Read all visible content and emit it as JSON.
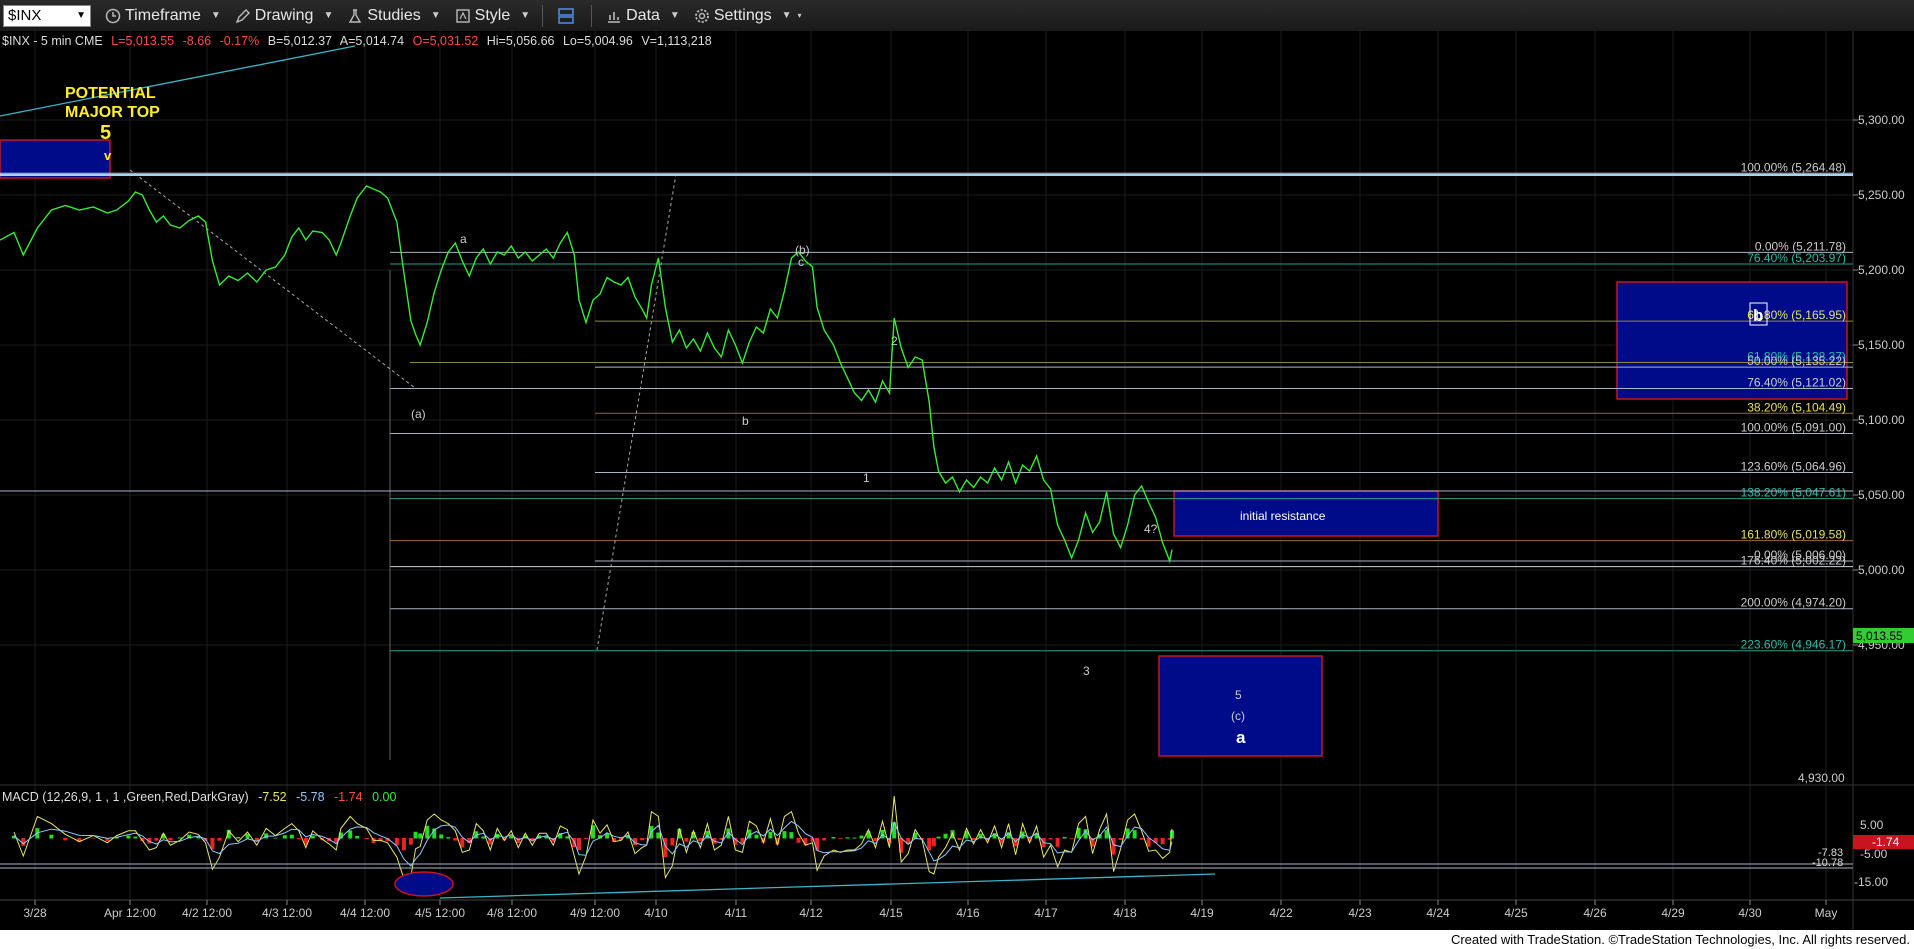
{
  "toolbar": {
    "symbol": "$INX",
    "timeframe": "Timeframe",
    "drawing": "Drawing",
    "studies": "Studies",
    "style": "Style",
    "data": "Data",
    "settings": "Settings"
  },
  "footer": "Created with TradeStation. ©TradeStation Technologies, Inc. All rights reserved.",
  "colors": {
    "price_line": "#33ee33",
    "fib_line": "#aab4c8",
    "box_fill": "#000b8a",
    "box_stroke": "#c8141e",
    "label_yellow": "#ffee22"
  },
  "chart_data": {
    "type": "line",
    "header": {
      "symbol": "$INX - 5 min  CME",
      "last": "L=5,013.55",
      "change": "-8.66",
      "pct": "-0.17%",
      "bid": "B=5,012.37",
      "ask": "A=5,014.74",
      "open": "O=5,031.52",
      "high": "Hi=5,056.66",
      "low": "Lo=5,004.96",
      "volume": "V=1,113,218"
    },
    "x_ticks": [
      "3/28",
      "Apr 12:00",
      "4/2 12:00",
      "4/3 12:00",
      "4/4 12:00",
      "4/5 12:00",
      "4/8 12:00",
      "4/9 12:00",
      "4/10",
      "4/11",
      "4/12",
      "4/15",
      "4/16",
      "4/17",
      "4/18",
      "4/19",
      "4/22",
      "4/23",
      "4/24",
      "4/25",
      "4/26",
      "4/29",
      "4/30",
      "May"
    ],
    "y_ticks": [
      "5,300.00",
      "5,250.00",
      "5,200.00",
      "5,150.00",
      "5,100.00",
      "5,050.00",
      "5,000.00",
      "4,950.00"
    ],
    "ylim": [
      4930,
      5325
    ],
    "last_price_badge": "5,013.55",
    "low_label": "4,930.00",
    "price_series": [
      [
        0,
        5220
      ],
      [
        6,
        5225
      ],
      [
        10,
        5210
      ],
      [
        16,
        5228
      ],
      [
        22,
        5240
      ],
      [
        28,
        5243
      ],
      [
        34,
        5240
      ],
      [
        40,
        5242
      ],
      [
        46,
        5238
      ],
      [
        50,
        5240
      ],
      [
        55,
        5246
      ],
      [
        58,
        5252
      ],
      [
        61,
        5250
      ],
      [
        64,
        5240
      ],
      [
        67,
        5232
      ],
      [
        70,
        5236
      ],
      [
        73,
        5230
      ],
      [
        77,
        5228
      ],
      [
        81,
        5233
      ],
      [
        85,
        5236
      ],
      [
        88,
        5232
      ],
      [
        91,
        5206
      ],
      [
        94,
        5190
      ],
      [
        98,
        5196
      ],
      [
        102,
        5193
      ],
      [
        106,
        5198
      ],
      [
        110,
        5192
      ],
      [
        114,
        5200
      ],
      [
        118,
        5202
      ],
      [
        122,
        5210
      ],
      [
        125,
        5222
      ],
      [
        128,
        5228
      ],
      [
        131,
        5220
      ],
      [
        134,
        5226
      ],
      [
        138,
        5225
      ],
      [
        141,
        5220
      ],
      [
        144,
        5210
      ],
      [
        146,
        5218
      ],
      [
        150,
        5236
      ],
      [
        153,
        5248
      ],
      [
        157,
        5256
      ],
      [
        160,
        5254
      ],
      [
        163,
        5252
      ],
      [
        166,
        5248
      ],
      [
        170,
        5232
      ],
      [
        173,
        5198
      ],
      [
        176,
        5166
      ],
      [
        178,
        5157
      ],
      [
        180,
        5150
      ],
      [
        183,
        5165
      ],
      [
        186,
        5185
      ],
      [
        189,
        5200
      ],
      [
        192,
        5212
      ],
      [
        195,
        5218
      ],
      [
        198,
        5206
      ],
      [
        201,
        5196
      ],
      [
        204,
        5208
      ],
      [
        207,
        5214
      ],
      [
        210,
        5204
      ],
      [
        213,
        5212
      ],
      [
        216,
        5210
      ],
      [
        219,
        5216
      ],
      [
        222,
        5208
      ],
      [
        225,
        5212
      ],
      [
        228,
        5206
      ],
      [
        231,
        5210
      ],
      [
        234,
        5214
      ],
      [
        237,
        5208
      ],
      [
        240,
        5218
      ],
      [
        243,
        5225
      ],
      [
        246,
        5210
      ],
      [
        248,
        5180
      ],
      [
        251,
        5165
      ],
      [
        254,
        5180
      ],
      [
        257,
        5184
      ],
      [
        260,
        5195
      ],
      [
        263,
        5192
      ],
      [
        266,
        5190
      ],
      [
        269,
        5195
      ],
      [
        272,
        5182
      ],
      [
        275,
        5174
      ],
      [
        277,
        5168
      ],
      [
        279,
        5190
      ],
      [
        282,
        5208
      ],
      [
        285,
        5175
      ],
      [
        288,
        5152
      ],
      [
        291,
        5160
      ],
      [
        294,
        5148
      ],
      [
        297,
        5154
      ],
      [
        300,
        5146
      ],
      [
        303,
        5158
      ],
      [
        306,
        5148
      ],
      [
        309,
        5142
      ],
      [
        312,
        5160
      ],
      [
        315,
        5150
      ],
      [
        318,
        5138
      ],
      [
        321,
        5152
      ],
      [
        324,
        5162
      ],
      [
        327,
        5158
      ],
      [
        330,
        5174
      ],
      [
        333,
        5168
      ],
      [
        336,
        5186
      ],
      [
        339,
        5208
      ],
      [
        342,
        5212
      ],
      [
        345,
        5206
      ],
      [
        348,
        5202
      ],
      [
        350,
        5175
      ],
      [
        353,
        5160
      ],
      [
        357,
        5150
      ],
      [
        360,
        5138
      ],
      [
        363,
        5128
      ],
      [
        366,
        5118
      ],
      [
        369,
        5113
      ],
      [
        372,
        5120
      ],
      [
        375,
        5112
      ],
      [
        378,
        5126
      ],
      [
        381,
        5118
      ],
      [
        383,
        5168
      ],
      [
        386,
        5148
      ],
      [
        389,
        5135
      ],
      [
        392,
        5142
      ],
      [
        395,
        5140
      ],
      [
        398,
        5112
      ],
      [
        400,
        5082
      ],
      [
        402,
        5066
      ],
      [
        405,
        5058
      ],
      [
        408,
        5062
      ],
      [
        411,
        5052
      ],
      [
        414,
        5060
      ],
      [
        417,
        5055
      ],
      [
        420,
        5062
      ],
      [
        423,
        5058
      ],
      [
        426,
        5068
      ],
      [
        429,
        5060
      ],
      [
        432,
        5072
      ],
      [
        435,
        5058
      ],
      [
        438,
        5070
      ],
      [
        441,
        5066
      ],
      [
        444,
        5076
      ],
      [
        447,
        5060
      ],
      [
        450,
        5054
      ],
      [
        453,
        5030
      ],
      [
        456,
        5020
      ],
      [
        459,
        5008
      ],
      [
        462,
        5020
      ],
      [
        465,
        5038
      ],
      [
        468,
        5025
      ],
      [
        471,
        5032
      ],
      [
        474,
        5052
      ],
      [
        477,
        5024
      ],
      [
        480,
        5015
      ],
      [
        483,
        5030
      ],
      [
        486,
        5050
      ],
      [
        489,
        5056
      ],
      [
        492,
        5045
      ],
      [
        495,
        5035
      ],
      [
        498,
        5018
      ],
      [
        501,
        5006
      ],
      [
        502,
        5013.55
      ]
    ],
    "price_x_range": [
      0,
      502
    ],
    "fib_levels": [
      {
        "label": "100.00% (5,264.48)",
        "value": 5264.48
      },
      {
        "label": "0.00% (5,211.78)",
        "value": 5211.78
      },
      {
        "label": "76.40% (5,203.97)",
        "value": 5203.97
      },
      {
        "label": "61.80% (5,165.95)",
        "value": 5165.95
      },
      {
        "label": "61.80% (5,138.37)",
        "value": 5138.37
      },
      {
        "label": "50.00% (5,135.22)",
        "value": 5135.22
      },
      {
        "label": "76.40% (5,121.02)",
        "value": 5121.02
      },
      {
        "label": "38.20% (5,104.49)",
        "value": 5104.49
      },
      {
        "label": "100.00% (5,091.00)",
        "value": 5091.0
      },
      {
        "label": "123.60% (5,064.96)",
        "value": 5064.96
      },
      {
        "label": "138.20% (5,047.61)",
        "value": 5047.61
      },
      {
        "label": "161.80% (5,019.58)",
        "value": 5019.58
      },
      {
        "label": "0.00% (5,006.00)",
        "value": 5006.0
      },
      {
        "label": "176.40% (5,002.22)",
        "value": 5002.22
      },
      {
        "label": "200.00% (4,974.20)",
        "value": 4974.2
      },
      {
        "label": "223.60% (4,946.17)",
        "value": 4946.17
      }
    ],
    "wave_labels": {
      "potential": "POTENTIAL",
      "major_top": "MAJOR TOP",
      "five": "5",
      "v": "v",
      "a_small": "a",
      "paren_a": "(a)",
      "paren_b": "(b)",
      "c": "c",
      "b_small": "b",
      "one": "1",
      "two": "2",
      "three": "3",
      "four_q": "4?",
      "five_small": "5",
      "paren_c": "(c)",
      "a_big": "a",
      "b_box": "b",
      "initial_resistance": "initial resistance"
    },
    "macd": {
      "title": "MACD (12,26,9, 1 , 1 ,Green,Red,DarkGray)",
      "macd": "-7.52",
      "signal": "-5.78",
      "hist": "-1.74",
      "zero": "0.00",
      "y_ticks": [
        "5.00",
        "-5.00",
        "-15.00"
      ],
      "badge": "-1.74",
      "v1": "-7.83",
      "v2": "-10.78"
    }
  }
}
